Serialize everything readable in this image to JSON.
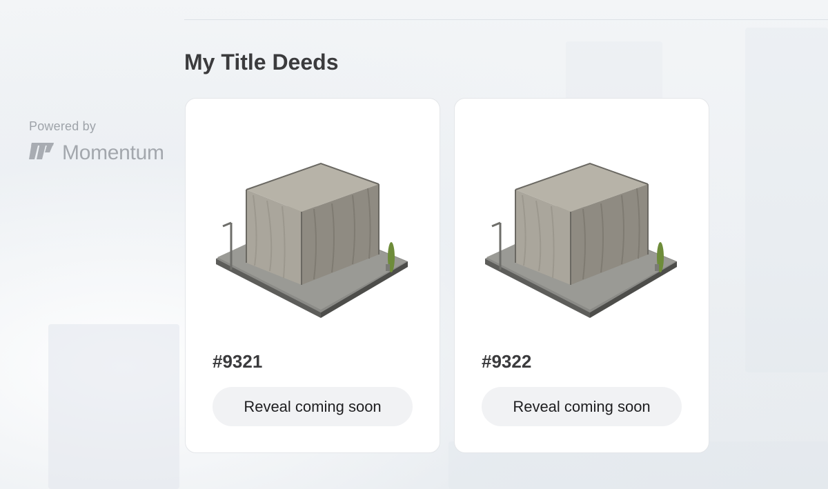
{
  "sidebar": {
    "powered_by": "Powered by",
    "brand_name": "Momentum",
    "brand_icon": "momentum-logo-icon"
  },
  "main": {
    "title": "My Title Deeds",
    "deeds": [
      {
        "id_label": "#9321",
        "image": "scaffolded-building-image",
        "action_label": "Reveal coming soon"
      },
      {
        "id_label": "#9322",
        "image": "scaffolded-building-image",
        "action_label": "Reveal coming soon"
      }
    ]
  },
  "colors": {
    "background": "#eef1f4",
    "card": "#ffffff",
    "button_bg": "#f1f2f4",
    "title_text": "#3b3b3d",
    "muted_text": "#9ea3a9"
  }
}
